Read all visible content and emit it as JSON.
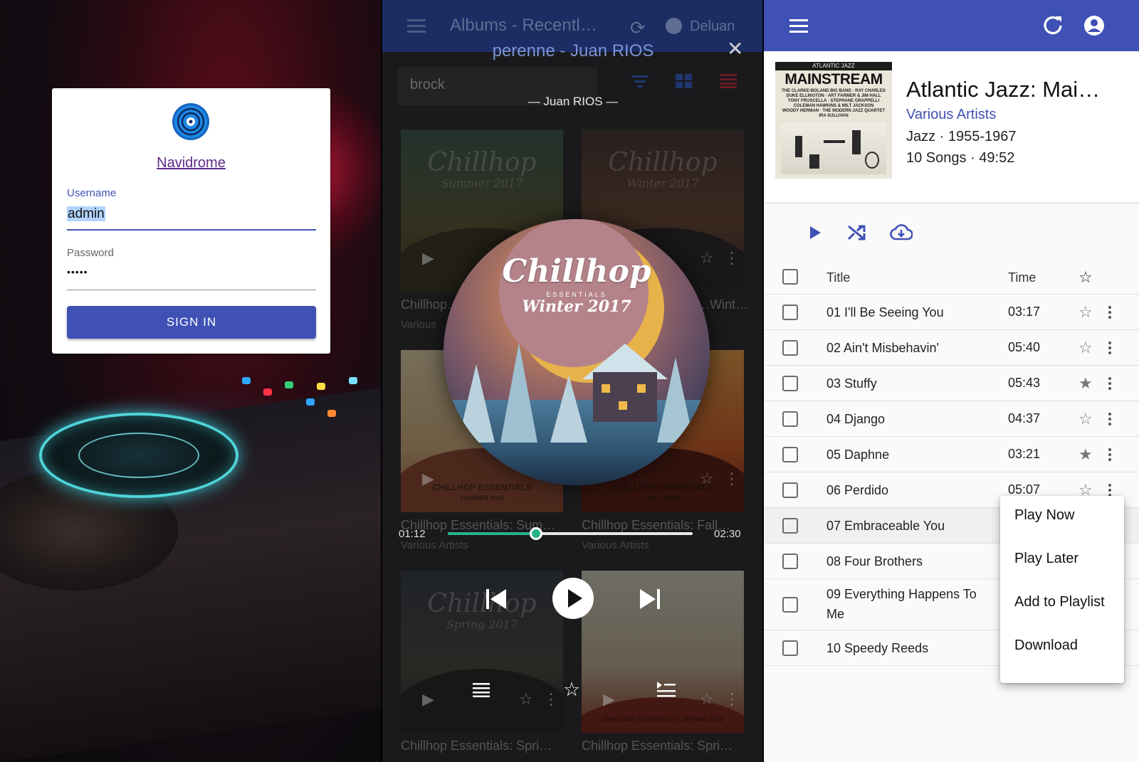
{
  "login": {
    "app_name": "Navidrome",
    "username_label": "Username",
    "username_value": "admin",
    "password_label": "Password",
    "password_value": "•••••",
    "signin_label": "SIGN IN"
  },
  "player": {
    "appbar_title": "Albums - Recentl…",
    "user": "Deluan",
    "song_title": "perenne - Juan RIOS",
    "artist_line": "— Juan RIOS —",
    "search_value": "brock",
    "now_playing_art": {
      "title": "Chillhop",
      "essentials": "ESSENTIALS",
      "subtitle": "Winter 2017"
    },
    "elapsed": "01:12",
    "total": "02:30",
    "progress": 0.36,
    "tiles": [
      {
        "art_word": "Chillhop",
        "art_sub": "Summer 2017",
        "caption": "Chillhop…",
        "artist": "Various"
      },
      {
        "art_word": "Chillhop",
        "art_sub": "Winter 2017",
        "caption": "…Wint…",
        "artist": ""
      },
      {
        "art_word": "",
        "art_sub": "",
        "art_ess": "CHILLHOP ESSENTIALS",
        "art_ess_sub": "SUMMER 2018",
        "caption": "Chillhop Essentials: Sum…",
        "artist": "Various Artists"
      },
      {
        "art_word": "",
        "art_sub": "",
        "art_ess": "CHILLHOP ESSENTIALS",
        "art_ess_sub": "FALL 2018",
        "caption": "Chillhop Essentials: Fall…",
        "artist": "Various Artists"
      },
      {
        "art_word": "Chillhop",
        "art_sub": "Spring 2017",
        "caption": "Chillhop Essentials: Spri…",
        "artist": ""
      },
      {
        "art_word": "",
        "art_sub": "",
        "art_ess": "CHILLHOP ESSENTIALS · SPRING 2018",
        "caption": "Chillhop Essentials: Spri…",
        "artist": ""
      }
    ],
    "colors": {
      "accent": "#27b38a",
      "appbar": "#1c2d63"
    }
  },
  "album": {
    "cover": {
      "top_line": "ATLANTIC JAZZ",
      "title": "MAINSTREAM",
      "names": "THE CLARKE-BOLAND BIG BAND · RAY CHARLES\nDUKE ELLINGTON · ART FARMER & JIM HALL\nTONY FRUSCELLA · STEPHANE GRAPPELLI\nCOLEMAN HAWKINS & MILT JACKSON\nWOODY HERMAN · THE MODERN JAZZ QUARTET\nIRA SULLIVAN"
    },
    "title": "Atlantic Jazz: Mai…",
    "artist": "Various Artists",
    "genre_years": "Jazz · 1955-1967",
    "songs_duration": "10 Songs · 49:52",
    "columns": {
      "title": "Title",
      "time": "Time"
    },
    "tracks": [
      {
        "title": "01 I'll Be Seeing You",
        "time": "03:17",
        "starred": false
      },
      {
        "title": "02 Ain't Misbehavin'",
        "time": "05:40",
        "starred": false
      },
      {
        "title": "03 Stuffy",
        "time": "05:43",
        "starred": true
      },
      {
        "title": "04 Django",
        "time": "04:37",
        "starred": false
      },
      {
        "title": "05 Daphne",
        "time": "03:21",
        "starred": true
      },
      {
        "title": "06 Perdido",
        "time": "05:07",
        "starred": false
      },
      {
        "title": "07 Embraceable You",
        "time": "",
        "starred": false
      },
      {
        "title": "08 Four Brothers",
        "time": "",
        "starred": false
      },
      {
        "title": "09 Everything Happens To Me",
        "time": "",
        "starred": false
      },
      {
        "title": "10 Speedy Reeds",
        "time": "",
        "starred": false
      }
    ],
    "context_menu": [
      "Play Now",
      "Play Later",
      "Add to Playlist",
      "Download"
    ],
    "colors": {
      "primary": "#3f51b5"
    }
  }
}
